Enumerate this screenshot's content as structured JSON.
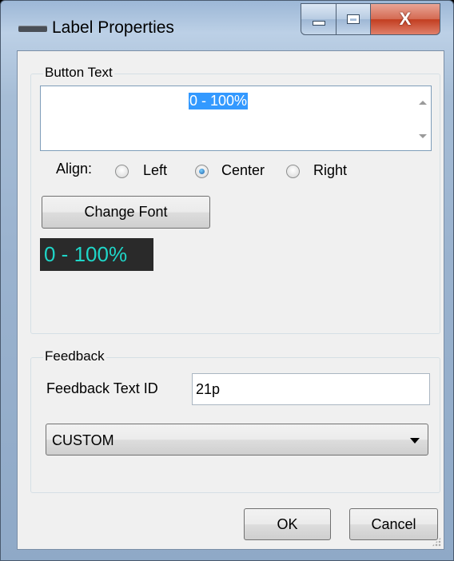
{
  "window": {
    "title": "Label Properties",
    "icon": "window-menu-icon",
    "controls": {
      "minimize": "minimize-icon",
      "maximize": "maximize-icon",
      "close_glyph": "X"
    }
  },
  "button_text_group": {
    "legend": "Button Text",
    "text_value": "0 - 100%",
    "align_label": "Align:",
    "align_options": [
      {
        "label": "Left",
        "checked": false
      },
      {
        "label": "Center",
        "checked": true
      },
      {
        "label": "Right",
        "checked": false
      }
    ],
    "change_font_label": "Change Font",
    "preview_text": "0 - 100%",
    "preview_colors": {
      "background": "#2a2a2a",
      "text": "#1fd6c8"
    }
  },
  "feedback_group": {
    "legend": "Feedback",
    "text_id_label": "Feedback Text ID",
    "text_id_value": "21p",
    "type_selected": "CUSTOM"
  },
  "footer": {
    "ok_label": "OK",
    "cancel_label": "Cancel"
  },
  "colors": {
    "selection": "#3399ff",
    "close_button": "#c23d1f"
  }
}
